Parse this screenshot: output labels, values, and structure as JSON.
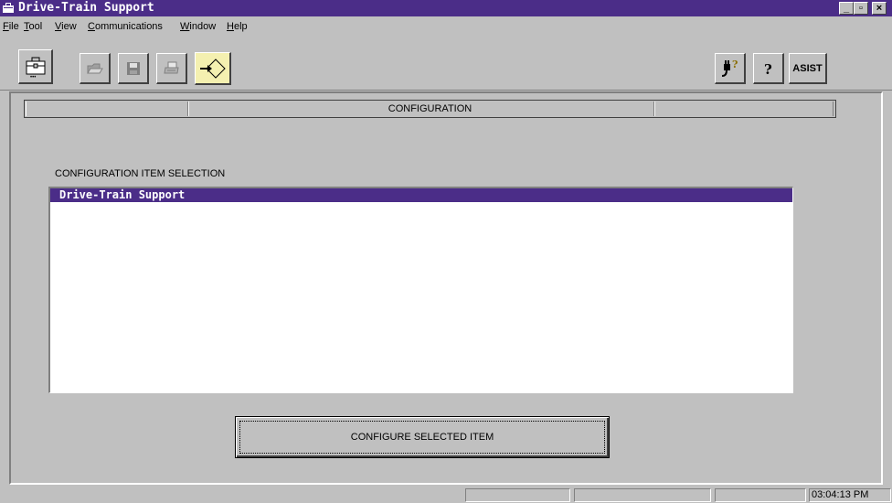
{
  "window": {
    "title": "Drive-Train Support",
    "controls": {
      "minimize": "_",
      "restore": "▫",
      "close": "×"
    }
  },
  "menu": [
    {
      "label": "File",
      "mnemonic": "F"
    },
    {
      "label": "Tool",
      "mnemonic": "T"
    },
    {
      "label": "View",
      "mnemonic": "V"
    },
    {
      "label": "Communications",
      "mnemonic": "C"
    },
    {
      "label": "Window",
      "mnemonic": "W"
    },
    {
      "label": "Help",
      "mnemonic": "H"
    }
  ],
  "toolbar": {
    "left_icons": [
      "toolbox-icon",
      "open-folder-icon",
      "save-icon",
      "print-icon",
      "diamond-arrow-icon"
    ],
    "right_icons": [
      "plug-help-icon",
      "help-icon"
    ],
    "asist_label": "ASIST"
  },
  "configuration": {
    "header_title": "CONFIGURATION",
    "selection_label": "CONFIGURATION ITEM SELECTION",
    "items": [
      "Drive-Train Support"
    ],
    "selected_index": 0,
    "button_label": "CONFIGURE SELECTED ITEM"
  },
  "status": {
    "time": "03:04:13 PM"
  },
  "colors": {
    "titlebar": "#4b2d88",
    "selection": "#4b2d88",
    "face": "#c0c0c0"
  }
}
